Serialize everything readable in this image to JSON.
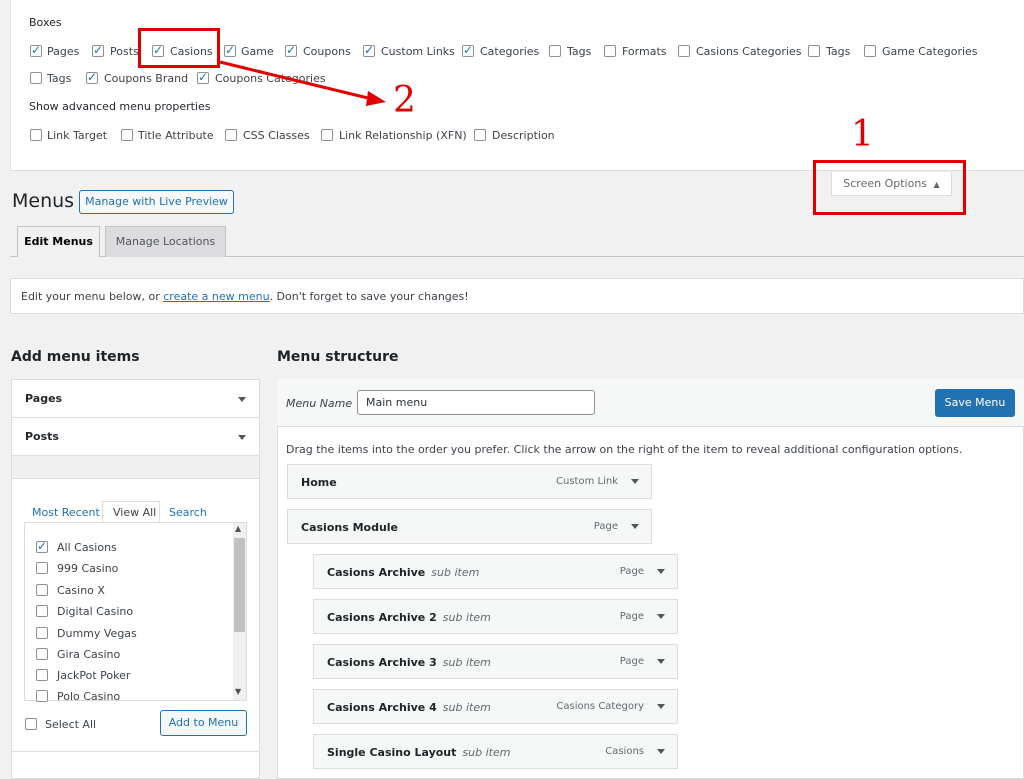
{
  "screen_options": {
    "boxes_title": "Boxes",
    "boxes": [
      {
        "label": "Pages",
        "checked": true
      },
      {
        "label": "Posts",
        "checked": true
      },
      {
        "label": "Casions",
        "checked": true
      },
      {
        "label": "Game",
        "checked": true
      },
      {
        "label": "Coupons",
        "checked": true
      },
      {
        "label": "Custom Links",
        "checked": true
      },
      {
        "label": "Categories",
        "checked": true
      },
      {
        "label": "Tags",
        "checked": false
      },
      {
        "label": "Formats",
        "checked": false
      },
      {
        "label": "Casions Categories",
        "checked": false
      },
      {
        "label": "Tags",
        "checked": false
      },
      {
        "label": "Game Categories",
        "checked": false
      },
      {
        "label": "Tags",
        "checked": false
      },
      {
        "label": "Coupons Brand",
        "checked": true
      },
      {
        "label": "Coupons Categories",
        "checked": true
      }
    ],
    "advanced_title": "Show advanced menu properties",
    "advanced": [
      {
        "label": "Link Target",
        "checked": false
      },
      {
        "label": "Title Attribute",
        "checked": false
      },
      {
        "label": "CSS Classes",
        "checked": false
      },
      {
        "label": "Link Relationship (XFN)",
        "checked": false
      },
      {
        "label": "Description",
        "checked": false
      }
    ],
    "toggle_label": "Screen Options"
  },
  "annotations": {
    "num1": "1",
    "num2": "2"
  },
  "header": {
    "title": "Menus",
    "live_preview": "Manage with Live Preview"
  },
  "tabs": {
    "edit": "Edit Menus",
    "locations": "Manage Locations"
  },
  "notice": {
    "before": "Edit your menu below, or ",
    "link": "create a new menu",
    "after": ". Don't forget to save your changes!"
  },
  "add_items": {
    "title": "Add menu items",
    "pages": "Pages",
    "posts": "Posts",
    "subtabs": {
      "recent": "Most Recent",
      "all": "View All",
      "search": "Search"
    },
    "items": [
      {
        "label": "All Casions",
        "checked": true
      },
      {
        "label": "999 Casino",
        "checked": false
      },
      {
        "label": "Casino X",
        "checked": false
      },
      {
        "label": "Digital Casino",
        "checked": false
      },
      {
        "label": "Dummy Vegas",
        "checked": false
      },
      {
        "label": "Gira Casino",
        "checked": false
      },
      {
        "label": "JackPot Poker",
        "checked": false
      },
      {
        "label": "Polo Casino",
        "checked": false
      }
    ],
    "select_all": "Select All",
    "add_button": "Add to Menu"
  },
  "structure": {
    "title": "Menu structure",
    "menu_name_label": "Menu Name",
    "menu_name_value": "Main menu",
    "save_button": "Save Menu",
    "instructions": "Drag the items into the order you prefer. Click the arrow on the right of the item to reveal additional configuration options.",
    "items": [
      {
        "title": "Home",
        "sub": "",
        "type": "Custom Link"
      },
      {
        "title": "Casions Module",
        "sub": "",
        "type": "Page"
      },
      {
        "title": "Casions Archive",
        "sub": "sub item",
        "type": "Page"
      },
      {
        "title": "Casions Archive 2",
        "sub": "sub item",
        "type": "Page"
      },
      {
        "title": "Casions Archive 3",
        "sub": "sub item",
        "type": "Page"
      },
      {
        "title": "Casions Archive 4",
        "sub": "sub item",
        "type": "Casions Category"
      },
      {
        "title": "Single Casino Layout",
        "sub": "sub item",
        "type": "Casions"
      }
    ]
  },
  "colors": {
    "accent": "#2271b1",
    "annotation": "#e00000"
  }
}
